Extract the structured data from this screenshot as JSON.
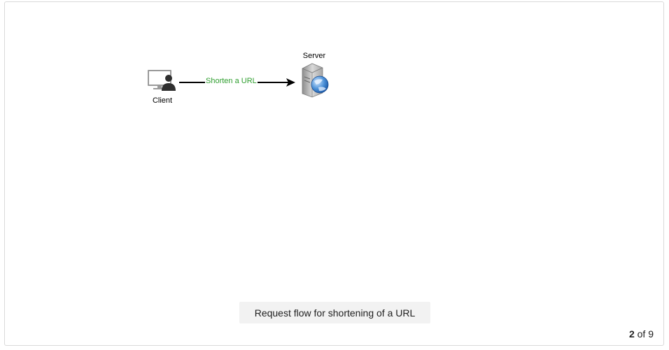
{
  "diagram": {
    "client_label": "Client",
    "server_label": "Server",
    "edge_label": "Shorten a URL",
    "edge_color": "#2e9e2e"
  },
  "caption": "Request flow for shortening of a URL",
  "pager": {
    "current": "2",
    "separator": "of",
    "total": "9"
  }
}
